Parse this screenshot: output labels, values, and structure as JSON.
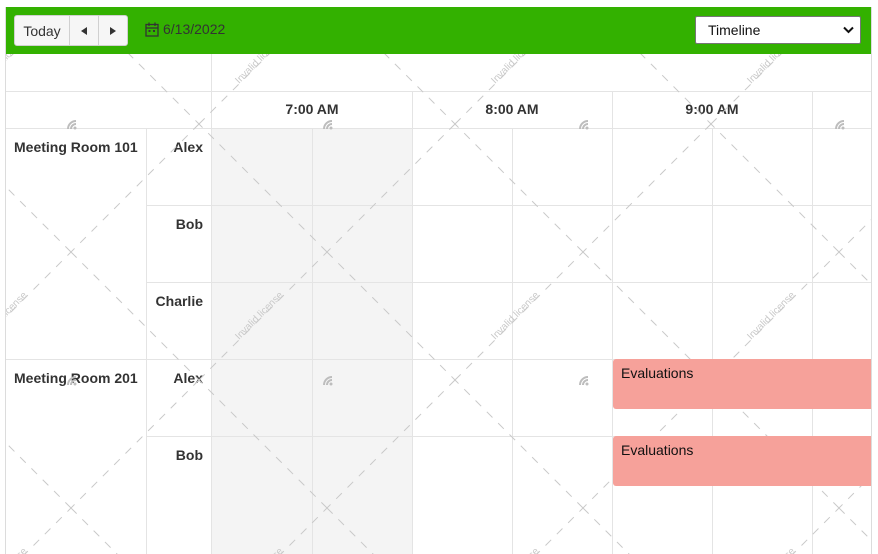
{
  "toolbar": {
    "today_label": "Today",
    "prev_icon": "caret-left-icon",
    "next_icon": "caret-right-icon",
    "calendar_icon": "calendar-icon",
    "date_value": "6/13/2022",
    "view_select_value": "Timeline",
    "accent_color": "#33b100"
  },
  "timeline": {
    "times": [
      "7:00 AM",
      "8:00 AM",
      "9:00 AM"
    ],
    "rooms": [
      {
        "label": "Meeting Room 101",
        "people": [
          "Alex",
          "Bob",
          "Charlie"
        ]
      },
      {
        "label": "Meeting Room 201",
        "people": [
          "Alex",
          "Bob"
        ]
      }
    ]
  },
  "events": [
    {
      "title": "Evaluations",
      "room": "Meeting Room 201",
      "person": "Alex",
      "color": "#f6a19a"
    },
    {
      "title": "Evaluations",
      "room": "Meeting Room 201",
      "person": "Bob",
      "color": "#f6a19a"
    }
  ],
  "watermark_text": "Invalid license"
}
